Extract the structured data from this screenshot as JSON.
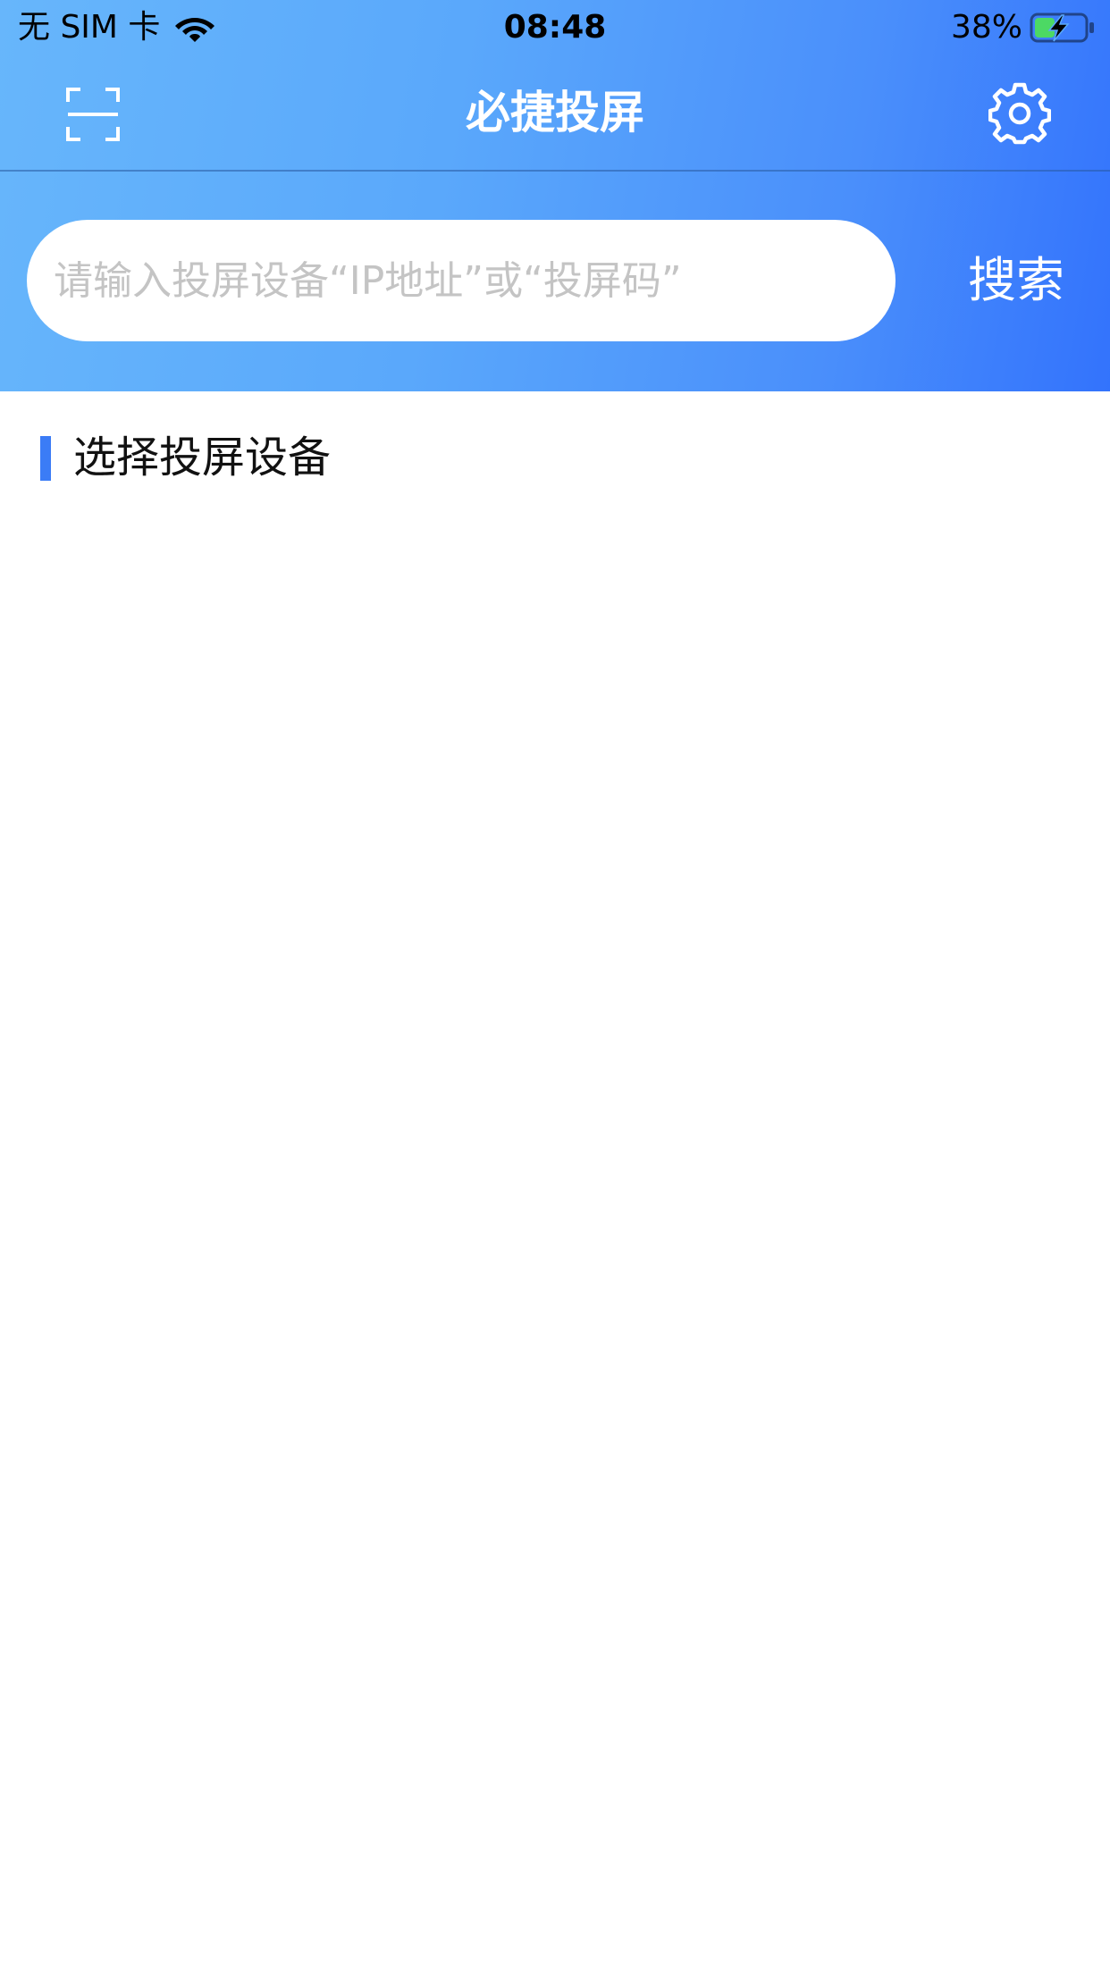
{
  "status_bar": {
    "carrier": "无 SIM 卡",
    "time": "08:48",
    "battery": "38%",
    "icons": [
      "wifi-icon",
      "battery-charging-icon"
    ]
  },
  "navbar": {
    "title": "必捷投屏",
    "left_icon": "scan-icon",
    "right_icon": "gear-icon"
  },
  "search": {
    "placeholder": "请输入投屏设备“IP地址”或“投屏码”",
    "value": "",
    "button_label": "搜索"
  },
  "devices_section": {
    "title": "选择投屏设备",
    "items": []
  },
  "colors": {
    "gradient_start": "#67b6fb",
    "gradient_end": "#3373fc",
    "accent_bar": "#3b7cf6",
    "battery_fill": "#4cd964"
  }
}
